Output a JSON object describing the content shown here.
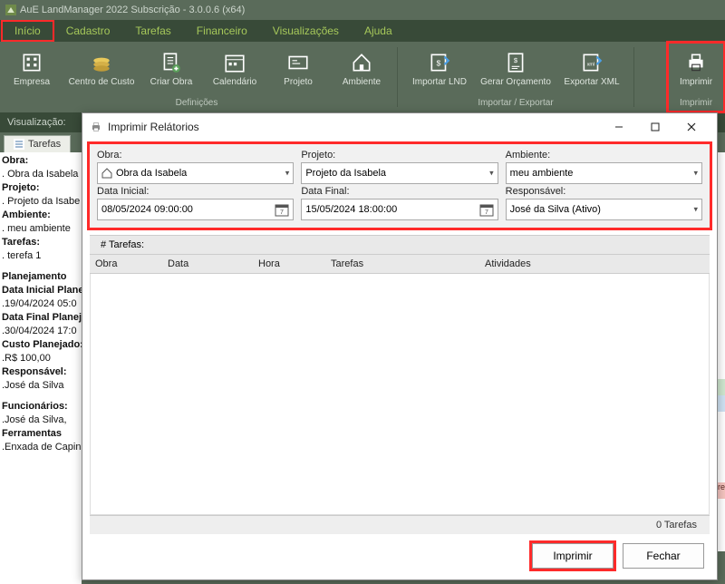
{
  "app": {
    "title": "AuE LandManager 2022 Subscrição - 3.0.0.6 (x64)"
  },
  "menu": {
    "items": [
      "Início",
      "Cadastro",
      "Tarefas",
      "Financeiro",
      "Visualizações",
      "Ajuda"
    ],
    "active_index": 0
  },
  "ribbon": {
    "group1": {
      "label": "Definições",
      "buttons": [
        "Empresa",
        "Centro de Custo",
        "Criar Obra",
        "Calendário",
        "Projeto",
        "Ambiente"
      ]
    },
    "group2": {
      "label": "Importar / Exportar",
      "buttons": [
        "Importar LND",
        "Gerar Orçamento",
        "Exportar XML"
      ]
    },
    "group3": {
      "label": "Imprimir",
      "button": "Imprimir"
    }
  },
  "visualization": {
    "label": "Visualização:",
    "tab": "Tarefas"
  },
  "side": {
    "obra_label": "Obra:",
    "obra": ". Obra da Isabela",
    "projeto_label": "Projeto:",
    "projeto": ". Projeto da Isabe",
    "ambiente_label": "Ambiente:",
    "ambiente": ". meu ambiente",
    "tarefas_label": "Tarefas:",
    "tarefa": ". terefa 1",
    "planejamento_label": "Planejamento",
    "data_inicial_label": "Data Inicial Plane",
    "data_inicial": ".19/04/2024 05:0",
    "data_final_label": "Data Final Planeja",
    "data_final": ".30/04/2024 17:0",
    "custo_label": "Custo Planejado:",
    "custo": ".R$ 100,00",
    "responsavel_label": "Responsável:",
    "responsavel": ".José da Silva",
    "funcionarios_label": "Funcionários:",
    "funcionarios": ".José da Silva,",
    "ferramentas_label": "Ferramentas",
    "ferramentas": ".Enxada de Capin"
  },
  "dialog": {
    "title": "Imprimir Relátorios",
    "filters": {
      "obra_label": "Obra:",
      "obra_value": "Obra da Isabela",
      "projeto_label": "Projeto:",
      "projeto_value": "Projeto da Isabela",
      "ambiente_label": "Ambiente:",
      "ambiente_value": "meu ambiente",
      "data_inicial_label": "Data Inicial:",
      "data_inicial_value": "08/05/2024 09:00:00",
      "data_final_label": "Data Final:",
      "data_final_value": "15/05/2024 18:00:00",
      "responsavel_label": "Responsável:",
      "responsavel_value": "José da Silva (Ativo)"
    },
    "count_label": "# Tarefas:",
    "columns": {
      "obra": "Obra",
      "data": "Data",
      "hora": "Hora",
      "tarefas": "Tarefas",
      "atividades": "Atividades"
    },
    "footer": "0 Tarefas",
    "print_btn": "Imprimir",
    "close_btn": "Fechar"
  },
  "right_red_text": "refa"
}
